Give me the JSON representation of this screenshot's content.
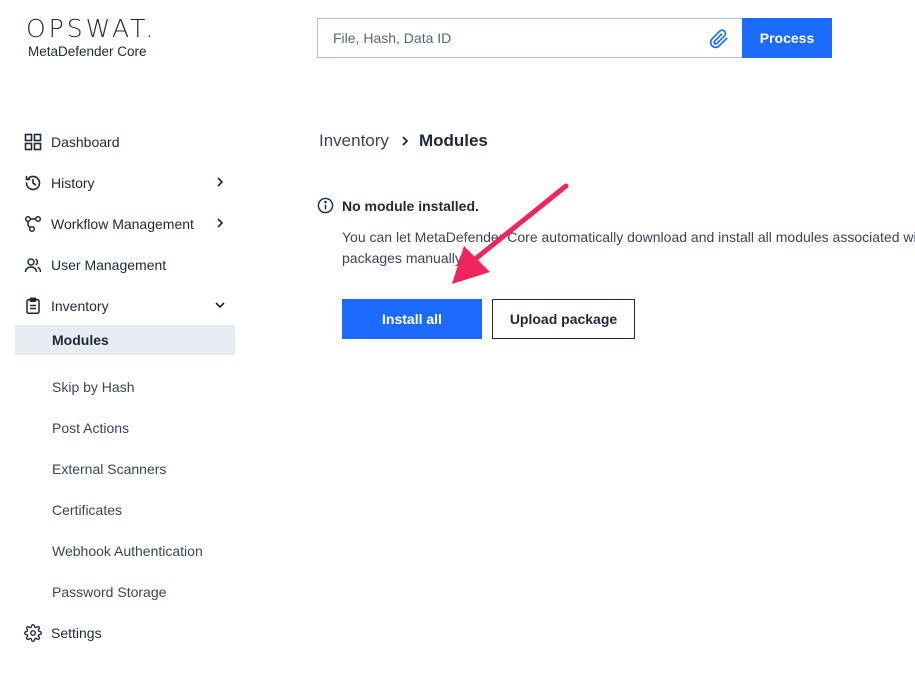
{
  "brand": {
    "logo": "OPSWAT.",
    "product": "MetaDefender Core"
  },
  "search": {
    "placeholder": "File, Hash, Data ID",
    "process_label": "Process"
  },
  "sidebar": {
    "items": [
      {
        "label": "Dashboard",
        "icon": "grid-icon"
      },
      {
        "label": "History",
        "icon": "history-icon"
      },
      {
        "label": "Workflow Management",
        "icon": "workflow-icon"
      },
      {
        "label": "User Management",
        "icon": "users-icon"
      },
      {
        "label": "Inventory",
        "icon": "clipboard-icon"
      },
      {
        "label": "Settings",
        "icon": "gear-icon"
      }
    ],
    "inventory_sub": [
      "Modules",
      "Skip by Hash",
      "Post Actions",
      "External Scanners",
      "Certificates",
      "Webhook Authentication",
      "Password Storage"
    ]
  },
  "breadcrumb": {
    "root": "Inventory",
    "current": "Modules"
  },
  "notice": {
    "title": "No module installed.",
    "line1": "You can let MetaDefender Core automatically download and install all modules associated with y",
    "line2": "packages manually."
  },
  "actions": {
    "install_all": "Install all",
    "upload_package": "Upload package"
  },
  "colors": {
    "accent": "#1d6bfc",
    "annotation_arrow": "#f0245f",
    "active_bg": "#e8ebf1"
  }
}
